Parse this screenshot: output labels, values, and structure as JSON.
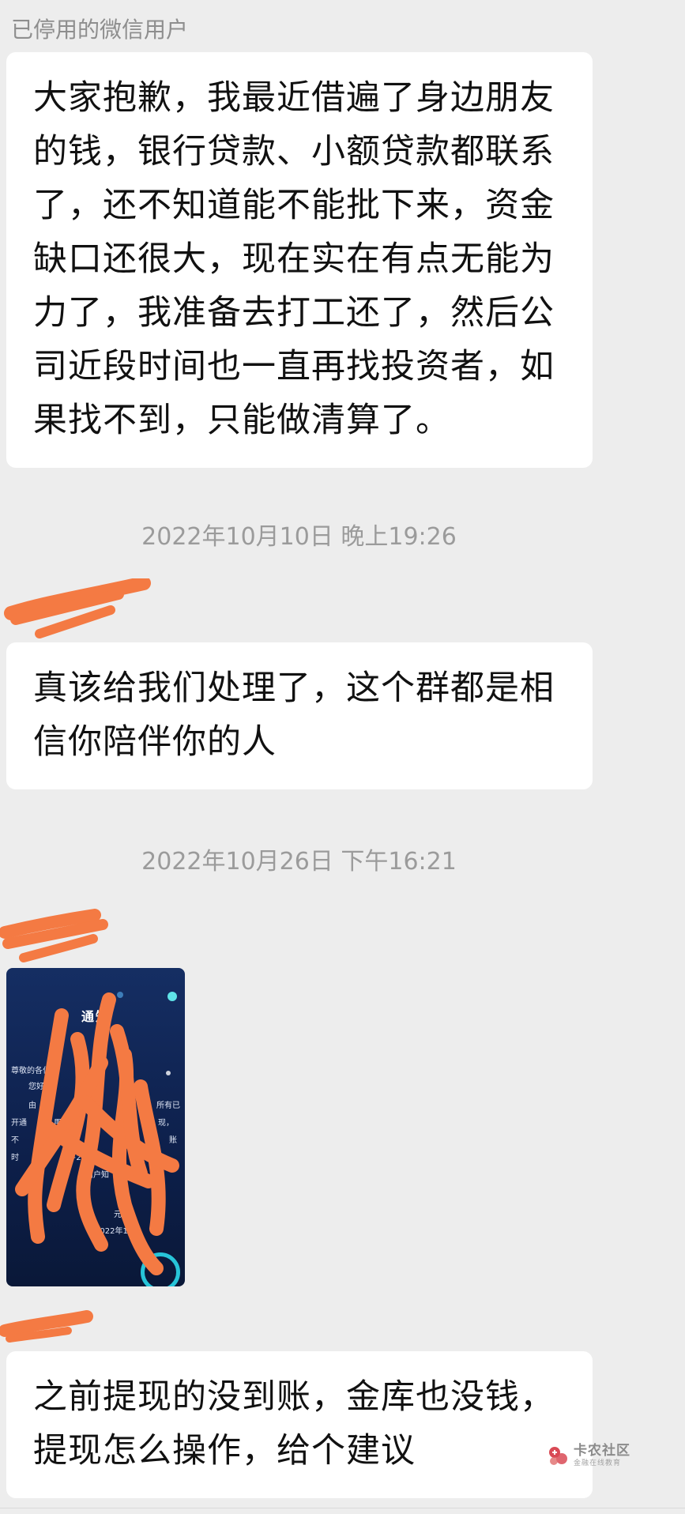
{
  "messages": [
    {
      "sender": "已停用的微信用户",
      "text": "大家抱歉，我最近借遍了身边朋友的钱，银行贷款、小额贷款都联系了，还不知道能不能批下来，资金缺口还很大，现在实在有点无能为力了，我准备去打工还了，然后公司近段时间也一直再找投资者，如果找不到，只能做清算了。"
    },
    {
      "timestamp": "2022年10月10日 晚上19:26",
      "text": "真该给我们处理了，这个群都是相信你陪伴你的人"
    },
    {
      "timestamp": "2022年10月26日 下午16:21",
      "image": {
        "title": "通知",
        "lines": [
          "尊敬的各位",
          "您好",
          "由",
          "所有已",
          "开通",
          "用户",
          "现，",
          "不",
          "账",
          "时",
          "+2。",
          "敬请",
          "用户知",
          "元(",
          "2022年10"
        ]
      }
    },
    {
      "text": "之前提现的没到账，金库也没钱，提现怎么操作，给个建议"
    }
  ],
  "watermark": {
    "main": "卡农社区",
    "sub": "金融在线教育"
  },
  "colors": {
    "background": "#ededed",
    "bubble": "#ffffff",
    "scribble": "#f47a43"
  }
}
